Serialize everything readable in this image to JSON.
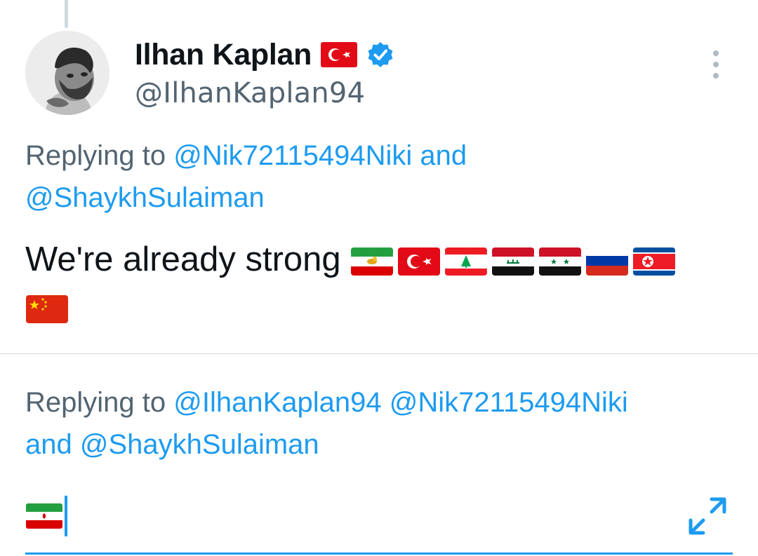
{
  "tweet": {
    "author": {
      "display_name": "Ilhan Kaplan",
      "name_flag": "turkey-flag",
      "verified_icon": "verified-badge-icon",
      "handle": "@IlhanKaplan94"
    },
    "reply_context": {
      "prefix": "Replying to",
      "mention_1": "@Nik72115494Niki",
      "joiner": "and",
      "mention_2": "@ShaykhSulaiman"
    },
    "text": "We're already strong",
    "text_flags": [
      "iran-lion-and-sun-flag",
      "turkey-flag",
      "lebanon-flag",
      "iraq-flag",
      "syria-flag",
      "russia-flag",
      "north-korea-flag",
      "china-flag"
    ]
  },
  "reply_composer": {
    "reply_context": {
      "prefix": "Replying to",
      "mention_1": "@IlhanKaplan94",
      "mention_2": "@Nik72115494Niki",
      "joiner": "and",
      "mention_3": "@ShaykhSulaiman"
    },
    "draft_flag": "iran-flag",
    "expand_icon": "expand-icon"
  },
  "colors": {
    "link": "#1d9bf0",
    "secondary_text": "#536471",
    "primary_text": "#0f1419",
    "divider": "#cfd9de"
  }
}
